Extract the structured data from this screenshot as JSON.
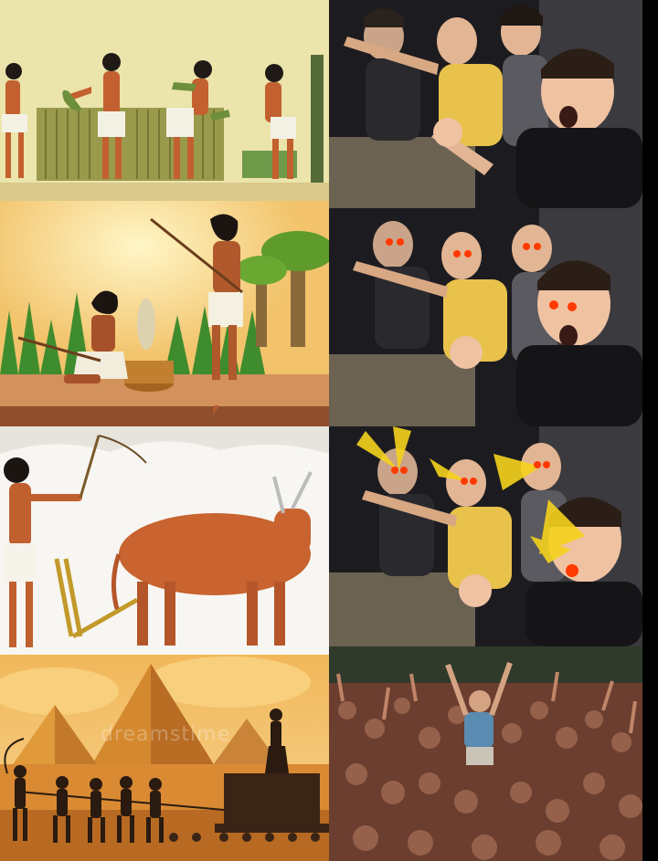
{
  "meme": {
    "layout": "4x2 grid",
    "left_column": [
      {
        "id": "harvest",
        "scene": "egyptian-harvest"
      },
      {
        "id": "fishing",
        "scene": "egyptian-fishing"
      },
      {
        "id": "plowing",
        "scene": "egyptian-plowing"
      },
      {
        "id": "pyramids",
        "scene": "pyramid-building"
      }
    ],
    "right_column": [
      {
        "id": "reaction-1",
        "scene": "pointing-guys"
      },
      {
        "id": "reaction-2",
        "scene": "pointing-guys-glowing-eyes"
      },
      {
        "id": "reaction-3",
        "scene": "pointing-guys-lasers"
      },
      {
        "id": "reaction-4",
        "scene": "crowd-surfing"
      }
    ],
    "watermark_text": "dreamstime",
    "colors": {
      "papyrus": "#e9e2a6",
      "sand": "#e3a24a",
      "skin": "#b8562a",
      "dark_room": "#1b1b1f",
      "laser": "#f5d21c",
      "glow": "#ff3a00"
    }
  }
}
